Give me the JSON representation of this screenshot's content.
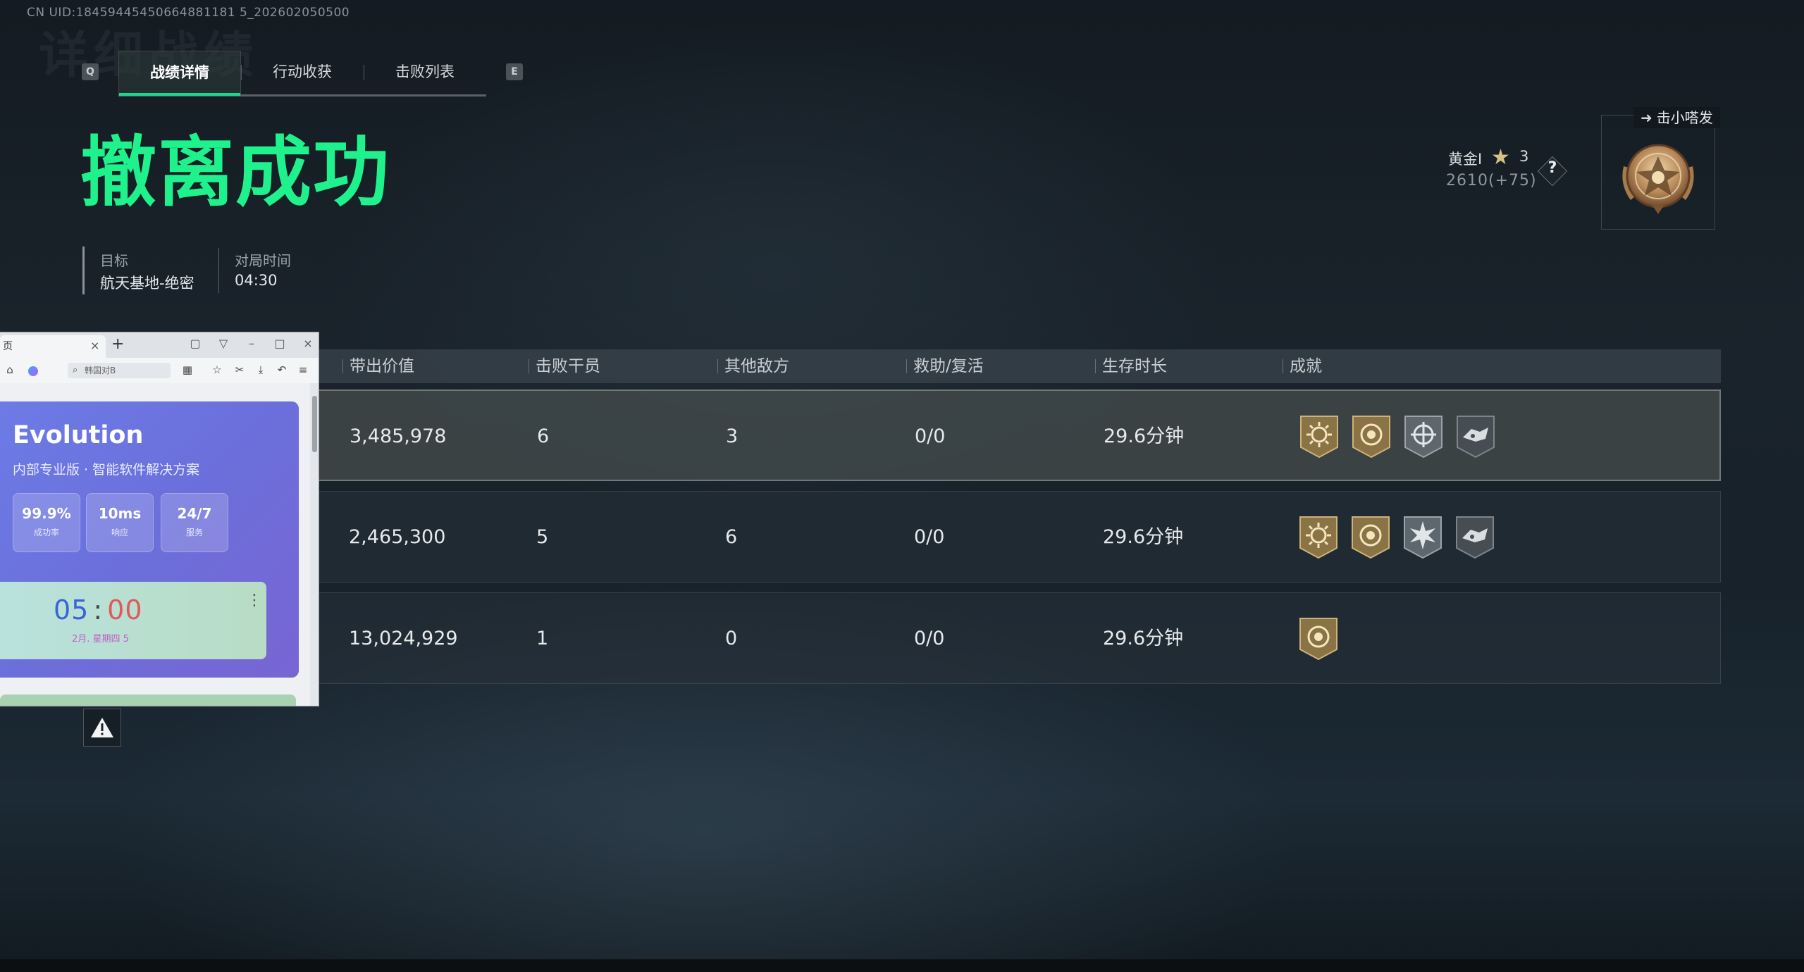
{
  "uid_text": "CN UID:18459445450664881181 5_202602050500",
  "tabs": {
    "left_key": "Q",
    "right_key": "E",
    "items": [
      "战绩详情",
      "行动收获",
      "击败列表"
    ]
  },
  "result_title": "撤离成功",
  "info": {
    "target_label": "目标",
    "target_value": "航天基地-绝密",
    "time_label": "对局时间",
    "time_value": "04:30"
  },
  "rank": {
    "name": "黄金I",
    "stars": "3",
    "points": "2610(+75)",
    "help": "?",
    "player_tag": "击小嗒发"
  },
  "table": {
    "headers": [
      "带出价值",
      "击败干员",
      "其他敌方",
      "救助/复活",
      "生存时长",
      "成就"
    ],
    "rows": [
      {
        "value": "3,485,978",
        "kills": "6",
        "others": "3",
        "rescue": "0/0",
        "survival": "29.6分钟",
        "achievements": [
          "sun-badge-icon",
          "target-badge-icon",
          "crosshair-badge-icon",
          "wings-badge-icon"
        ]
      },
      {
        "value": "2,465,300",
        "kills": "5",
        "others": "6",
        "rescue": "0/0",
        "survival": "29.6分钟",
        "achievements": [
          "sun-badge-icon",
          "target-badge-icon",
          "burst-badge-icon",
          "wings-badge-icon"
        ]
      },
      {
        "value": "13,024,929",
        "kills": "1",
        "others": "0",
        "rescue": "0/0",
        "survival": "29.6分钟",
        "achievements": [
          "target-badge-icon"
        ]
      }
    ]
  },
  "browser": {
    "tab_label": "页",
    "search_placeholder": "韩国对B",
    "app_title": "Evolution",
    "app_subtitle": "内部专业版 · 智能软件解决方案",
    "stats": [
      {
        "value": "99.9%",
        "label": "成功率"
      },
      {
        "value": "10ms",
        "label": "响应"
      },
      {
        "value": "24/7",
        "label": "服务"
      }
    ],
    "clock_hours": "05",
    "clock_sep": ":",
    "clock_minutes": "00",
    "clock_date": "2月. 星期四 5"
  },
  "colors": {
    "accent_green": "#1ff28c",
    "tab_underline": "#1fd690",
    "badge_gold": "#a8894e",
    "badge_silver": "#7d868c"
  }
}
